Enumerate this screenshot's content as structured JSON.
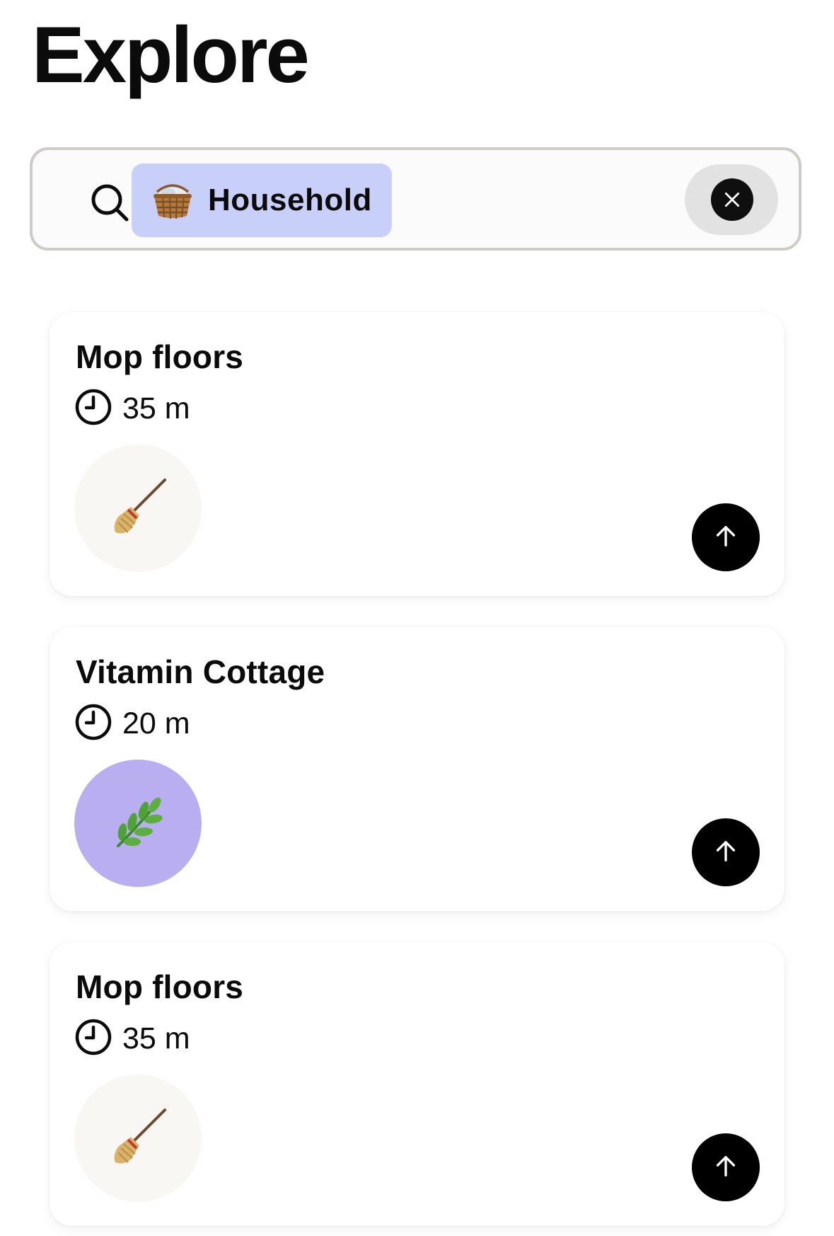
{
  "header": {
    "title": "Explore"
  },
  "search": {
    "icon": "search-icon",
    "filter_chip": {
      "label": "Household",
      "icon": "basket-icon",
      "color": "#c8cff9"
    },
    "clear_icon": "close-icon"
  },
  "tasks": [
    {
      "title": "Mop floors",
      "duration": "35 m",
      "icon": "broom-icon",
      "thumb_color": "#f9f7f3",
      "action_icon": "arrow-up-icon"
    },
    {
      "title": "Vitamin Cottage",
      "duration": "20 m",
      "icon": "herb-icon",
      "thumb_color": "#b9aef0",
      "action_icon": "arrow-up-icon"
    },
    {
      "title": "Mop floors",
      "duration": "35 m",
      "icon": "broom-icon",
      "thumb_color": "#f9f7f3",
      "action_icon": "arrow-up-icon"
    }
  ]
}
